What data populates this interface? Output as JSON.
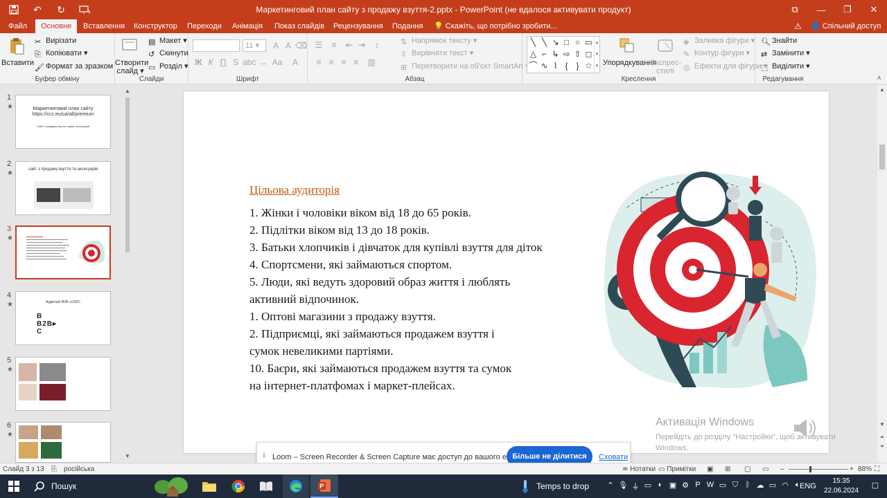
{
  "window": {
    "title": "Маркетинговий план сайту з продажу взуття-2.pptx - PowerPoint (не вдалося активувати продукт)"
  },
  "tabs": [
    "Файл",
    "Основне",
    "Вставлення",
    "Конструктор",
    "Переходи",
    "Анімація",
    "Показ слайдів",
    "Рецензування",
    "Подання"
  ],
  "tellme": "Скажіть, що потрібно зробити...",
  "share": "Спільний доступ",
  "ribbon": {
    "clipboard": {
      "paste": "Вставити",
      "cut": "Вирізати",
      "copy": "Копіювати",
      "format": "Формат за зразком",
      "label": "Буфер обміну"
    },
    "slides": {
      "new": "Створити",
      "new2": "слайд",
      "layout": "Макет",
      "reset": "Скинути",
      "section": "Розділ",
      "label": "Слайди"
    },
    "font": {
      "size": "11",
      "label": "Шрифт"
    },
    "paragraph": {
      "direction": "Напрямок тексту",
      "align": "Вирівняти текст",
      "smartart": "Перетворити на об'єкт SmartArt",
      "label": "Абзац"
    },
    "drawing": {
      "arrange": "Упорядкування",
      "styles": "Експрес-",
      "styles2": "стилі",
      "fill": "Заливка фігури",
      "outline": "Контур фігури",
      "effects": "Ефекти для фігури",
      "label": "Креслення"
    },
    "editing": {
      "find": "Знайти",
      "replace": "Замінити",
      "select": "Виділити",
      "label": "Редагування"
    }
  },
  "thumbnails": [
    {
      "num": "1",
      "text1": "Маркетинговий план сайту",
      "text2": "https://ccc.eu/ua/all/premium",
      "text3": "Сайт з продажу взуття, одягу, аксесуарів"
    },
    {
      "num": "2",
      "text1": "сайт з продажу взуття та аксесуарів"
    },
    {
      "num": "3"
    },
    {
      "num": "4",
      "text1": "Аудиторії B2B та B2C"
    },
    {
      "num": "5"
    },
    {
      "num": "6"
    }
  ],
  "slide": {
    "title": "Цільова аудиторія",
    "lines": [
      "1.   Жінки і чоловіки віком від 18 до 65 років.",
      "2.   Підлітки віком від 13 до 18 років.",
      "3.   Батьки хлопчиків і дівчаток для купівлі взуття для діток",
      "4.   Спортсмени, які займаються спортом.",
      "5.   Люди, які ведуть здоровий образ життя і люблять",
      "активний відпочинок.",
      "1.   Оптові магазини з продажу взуття.",
      "2.   Підприємці, які займаються продажем взуття і",
      "сумок невеликими партіями.",
      "10. Баєри, які займаються продажем взуття та сумок",
      "на інтернет-платфомах і маркет-плейсах."
    ]
  },
  "watermark": {
    "line1": "Активація Windows",
    "line2": "Перейдіть до розділу \"Настройки\", щоб активувати",
    "line3": "Windows."
  },
  "loom": {
    "message": "Loom – Screen Recorder & Screen Capture має доступ до вашого екрана.",
    "stop": "Більше не ділитися",
    "hide": "Сховати"
  },
  "status": {
    "slide": "Слайд 3 з 13",
    "lang": "російська",
    "notes": "Нотатки",
    "comments": "Примітки",
    "zoom": "88%"
  },
  "taskbar": {
    "search": "Пошук",
    "weather": "Temps to drop",
    "lang": "ENG",
    "time": "15:35",
    "date": "22.06.2024"
  },
  "colors": {
    "accent": "#c43e1c",
    "title": "#c55a11"
  }
}
